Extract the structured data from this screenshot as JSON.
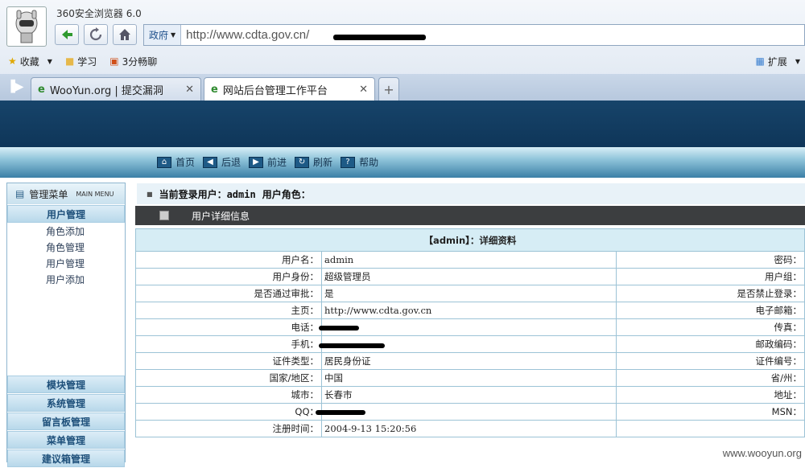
{
  "browser": {
    "app_title": "360安全浏览器 6.0",
    "zone": "政府",
    "url": "http://www.cdta.gov.cn/",
    "favorites": [
      "收藏",
      "学习",
      "3分畅聊"
    ],
    "extensions": "扩展",
    "tabs": [
      {
        "label": "WooYun.org | 提交漏洞",
        "active": false
      },
      {
        "label": "网站后台管理工作平台",
        "active": true
      }
    ],
    "new_tab": "+"
  },
  "site": {
    "nav": [
      "首页",
      "后退",
      "前进",
      "刷新",
      "帮助"
    ],
    "menu_title": "管理菜单",
    "menu_subtitle": "MAIN MENU",
    "groups_top": "用户管理",
    "sub_items": [
      "角色添加",
      "角色管理",
      "用户管理",
      "用户添加"
    ],
    "groups_bottom": [
      "模块管理",
      "系统管理",
      "留言板管理",
      "菜单管理",
      "建议箱管理"
    ],
    "login_label": "当前登录用户：",
    "login_user": "admin",
    "role_label": "用户角色："
  },
  "detail": {
    "header": "用户详细信息",
    "caption": "【admin】：详细资料",
    "rows": [
      {
        "label": "用户名：",
        "value": "admin",
        "label2": "密码："
      },
      {
        "label": "用户身份：",
        "value": "超级管理员",
        "label2": "用户组："
      },
      {
        "label": "是否通过审批：",
        "value": "是",
        "label2": "是否禁止登录："
      },
      {
        "label": "主页：",
        "value": "http://www.cdta.gov.cn",
        "label2": "电子邮箱："
      },
      {
        "label": "电话：",
        "value": "",
        "label2": "传真："
      },
      {
        "label": "手机：",
        "value": "",
        "label2": "邮政编码："
      },
      {
        "label": "证件类型：",
        "value": "居民身份证",
        "label2": "证件编号："
      },
      {
        "label": "国家/地区：",
        "value": "中国",
        "label2": "省/州："
      },
      {
        "label": "城市：",
        "value": "长春市",
        "label2": "地址："
      },
      {
        "label": "QQ：",
        "value": "",
        "label2": "MSN："
      },
      {
        "label": "注册时间：",
        "value": "2004-9-13 15:20:56",
        "label2": ""
      }
    ]
  },
  "watermark": "www.wooyun.org"
}
